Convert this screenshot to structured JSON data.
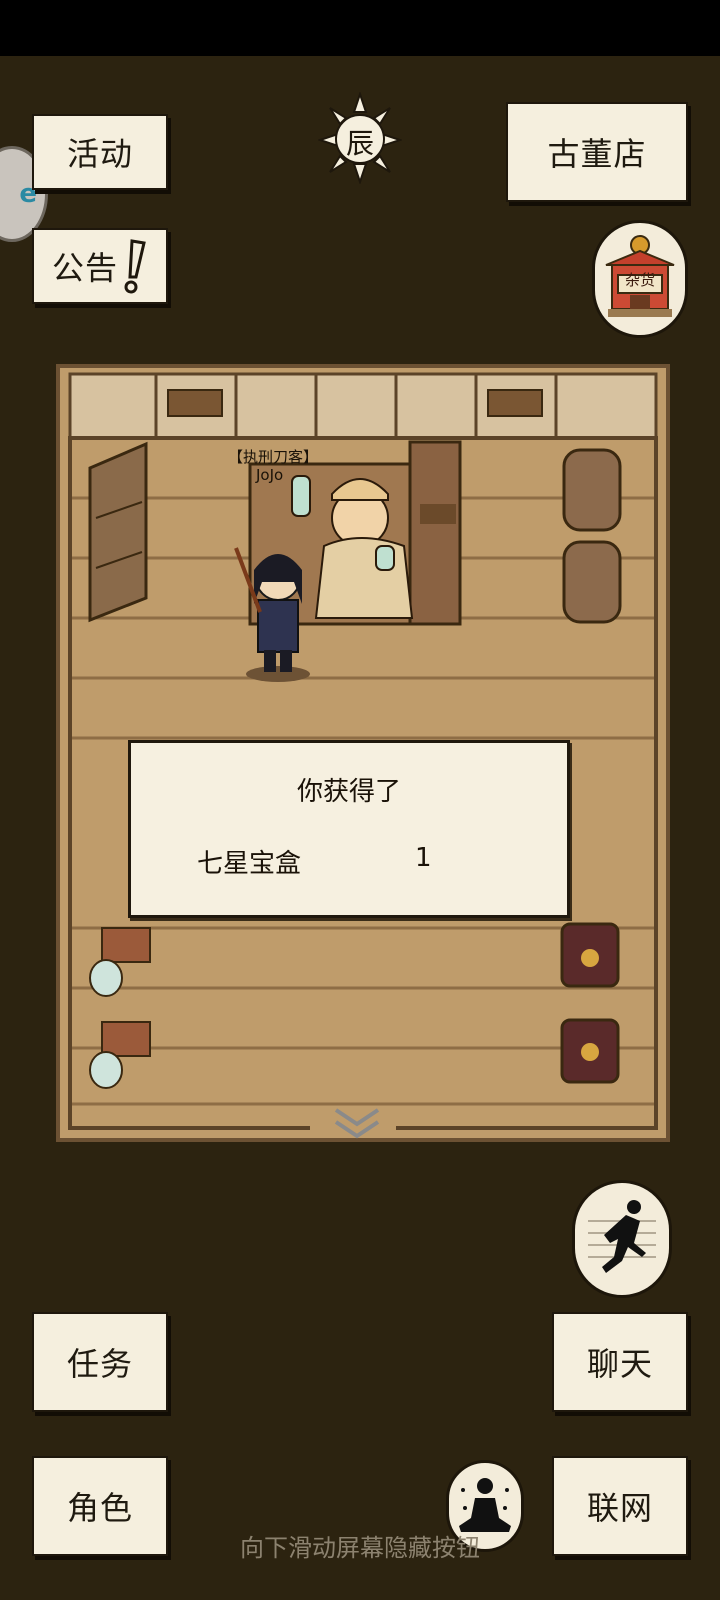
{
  "buttons": {
    "activity": "活动",
    "announcement": "公告",
    "antique_shop": "古董店",
    "tasks": "任务",
    "character": "角色",
    "chat": "聊天",
    "online": "联网"
  },
  "time_badge": "辰",
  "shop_badge": "杂货",
  "side_tab_label": "e",
  "npc": {
    "title": "【执刑刀客】",
    "name": "JoJo"
  },
  "dialog": {
    "heading": "你获得了",
    "item_name": "七星宝盒",
    "item_count": "1"
  },
  "hint": "向下滑动屏幕隐藏按钮",
  "colors": {
    "background": "#2c2310",
    "paper": "#f5efde",
    "floor": "#bf9c6b"
  },
  "icons": [
    "sun-time-icon",
    "shop-icon",
    "run-icon",
    "meditate-icon",
    "expand-down-icon",
    "exclamation-icon"
  ]
}
